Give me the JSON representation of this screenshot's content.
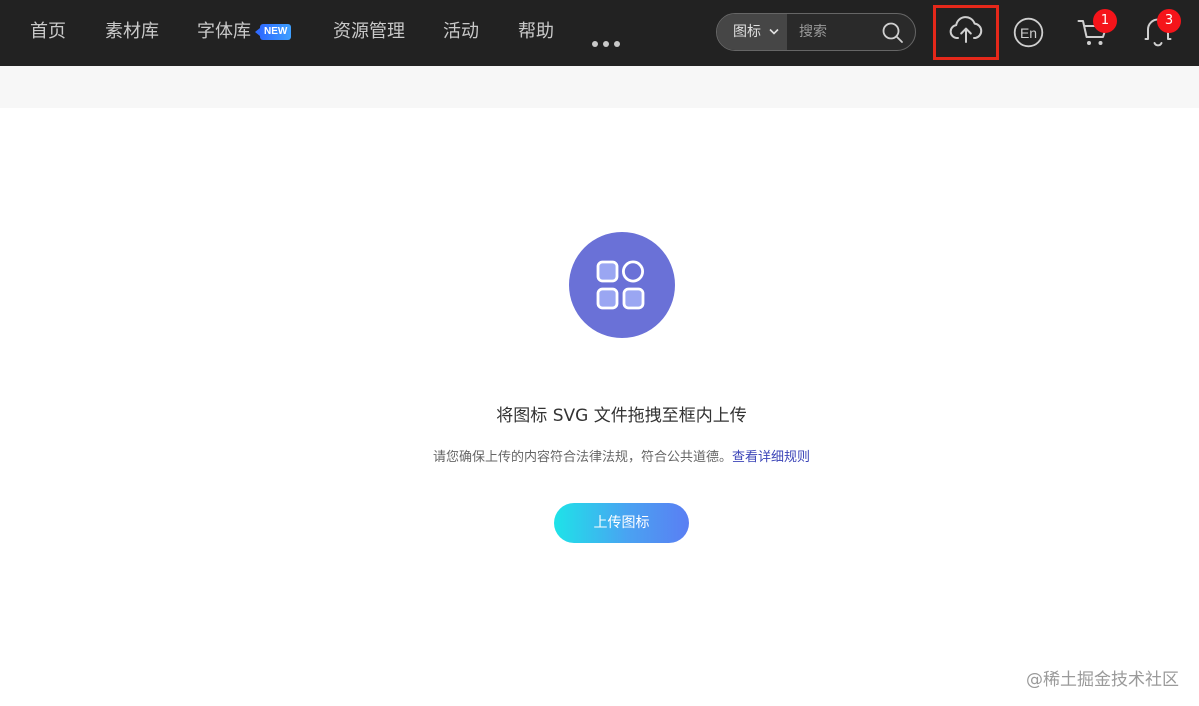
{
  "nav": {
    "items": [
      "首页",
      "素材库",
      "字体库",
      "资源管理",
      "活动",
      "帮助"
    ],
    "new_badge": "NEW"
  },
  "search": {
    "category": "图标",
    "placeholder": "搜索"
  },
  "header_icons": {
    "upload": "cloud-upload-icon",
    "language": "En",
    "cart_count": "1",
    "notification_count": "3"
  },
  "main": {
    "title": "将图标 SVG 文件拖拽至框内上传",
    "notice_text": "请您确保上传的内容符合法律法规，符合公共道德。",
    "notice_link": "查看详细规则",
    "upload_button": "上传图标"
  },
  "watermark": "@稀土掘金技术社区",
  "colors": {
    "topbar": "#222222",
    "accent": "#6a71d7",
    "link": "#3c45b8",
    "badge": "#f5141a",
    "highlight": "#e5281a"
  }
}
